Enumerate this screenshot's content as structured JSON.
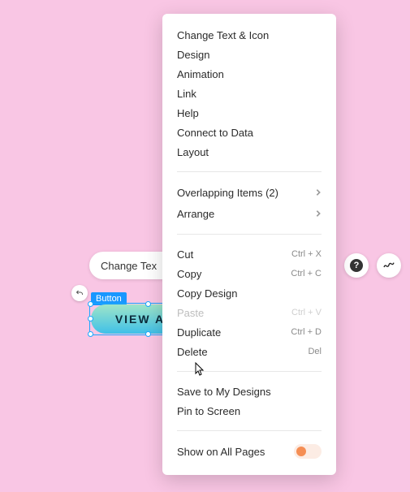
{
  "toolbar": {
    "changeText": "Change Tex"
  },
  "selection": {
    "tag": "Button",
    "buttonLabel": "VIEW ALL"
  },
  "menu": {
    "group1": [
      "Change Text & Icon",
      "Design",
      "Animation",
      "Link",
      "Help",
      "Connect to Data",
      "Layout"
    ],
    "group2": [
      {
        "label": "Overlapping Items (2)"
      },
      {
        "label": "Arrange"
      }
    ],
    "group3": [
      {
        "label": "Cut",
        "shortcut": "Ctrl + X"
      },
      {
        "label": "Copy",
        "shortcut": "Ctrl + C"
      },
      {
        "label": "Copy Design"
      },
      {
        "label": "Paste",
        "shortcut": "Ctrl + V",
        "disabled": true
      },
      {
        "label": "Duplicate",
        "shortcut": "Ctrl + D"
      },
      {
        "label": "Delete",
        "shortcut": "Del"
      }
    ],
    "group4": [
      "Save to My Designs",
      "Pin to Screen"
    ],
    "group5": {
      "label": "Show on All Pages",
      "enabled": false
    }
  }
}
